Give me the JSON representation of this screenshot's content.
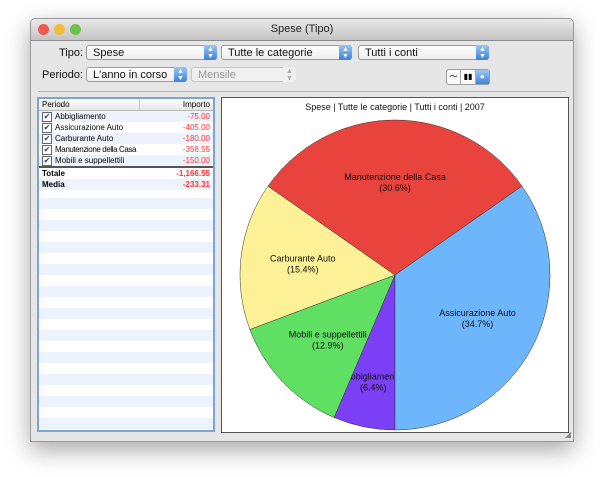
{
  "window": {
    "title": "Spese (Tipo)"
  },
  "toolbar": {
    "tipo_label": "Tipo:",
    "tipo_value": "Spese",
    "categoria_value": "Tutte le categorie",
    "conti_value": "Tutti i conti",
    "periodo_label": "Periodo:",
    "periodo_value": "L'anno in corso",
    "intervallo_value": "Mensile",
    "chart_modes": [
      "line",
      "bar",
      "pie"
    ],
    "selected_mode": "pie"
  },
  "table": {
    "headers": [
      "Periodo",
      "Importo"
    ],
    "rows": [
      {
        "name": "Abbigliamento",
        "value": "-75.00",
        "checked": true
      },
      {
        "name": "Assicurazione Auto",
        "value": "-405.00",
        "checked": true
      },
      {
        "name": "Carburante Auto",
        "value": "-180.00",
        "checked": true
      },
      {
        "name": "Manutenzione della Casa",
        "value": "-356.55",
        "checked": true
      },
      {
        "name": "Mobili e suppellettili",
        "value": "-150.00",
        "checked": true
      }
    ],
    "totale_label": "Totale",
    "totale_value": "-1,166.55",
    "media_label": "Media",
    "media_value": "-233.31"
  },
  "chart_data": {
    "type": "pie",
    "title": "Spese | Tutte le categorie | Tutti i conti | 2007",
    "slices": [
      {
        "label": "Abbigliamento",
        "percent_label": "(6.4%)",
        "value": 75.0,
        "color": "#7b3ff5"
      },
      {
        "label": "Mobili e suppellettili",
        "percent_label": "(12.9%)",
        "value": 150.0,
        "color": "#5fe062"
      },
      {
        "label": "Carburante Auto",
        "percent_label": "(15.4%)",
        "value": 180.0,
        "color": "#fdf197"
      },
      {
        "label": "Manutenzione della Casa",
        "percent_label": "(30.6%)",
        "value": 356.55,
        "color": "#e8433c"
      },
      {
        "label": "Assicurazione Auto",
        "percent_label": "(34.7%)",
        "value": 405.0,
        "color": "#6db6fc"
      }
    ]
  }
}
